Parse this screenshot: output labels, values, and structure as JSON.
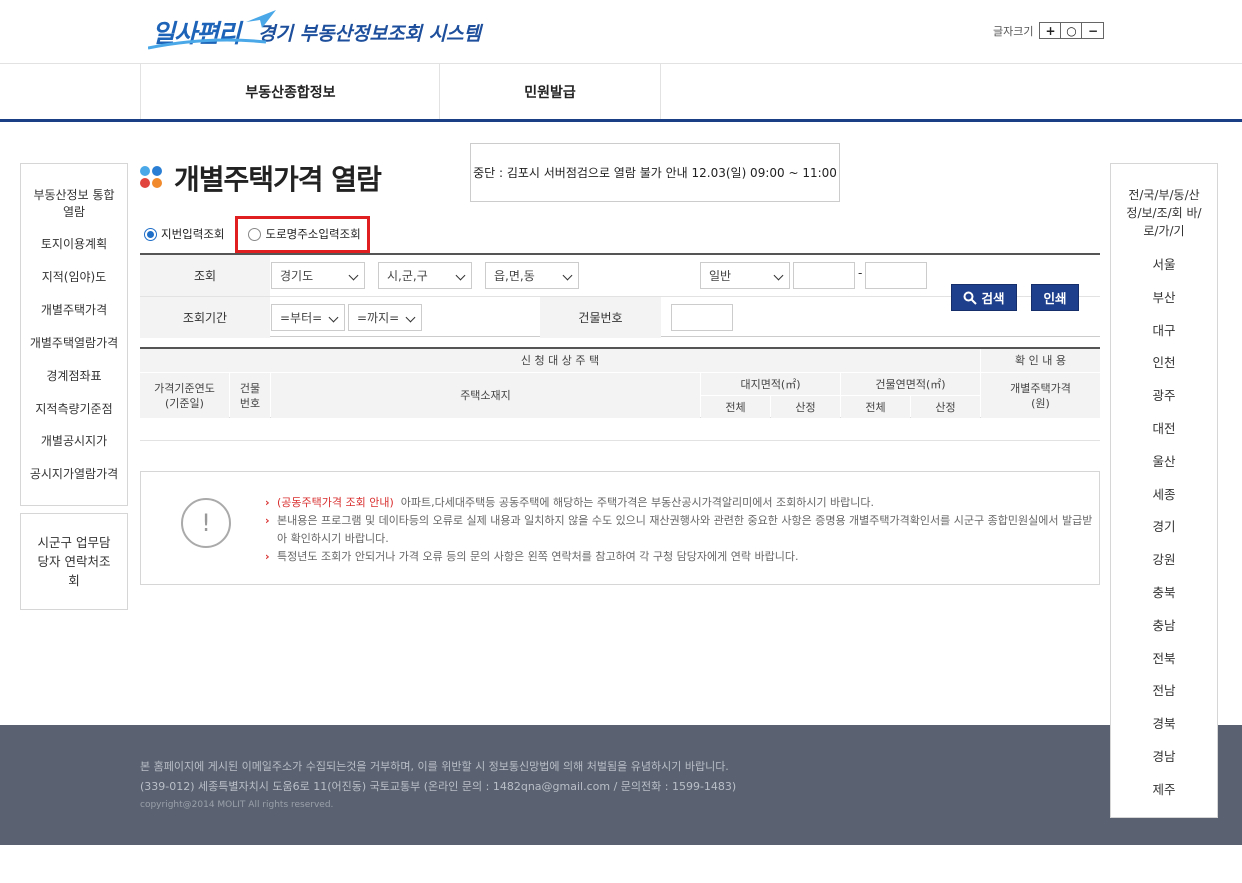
{
  "header": {
    "logo_mark": "일사편리",
    "title": "경기 부동산정보조회 시스템",
    "fontsize_label": "글자크기",
    "fontsize_buttons": [
      "+",
      "○",
      "−"
    ]
  },
  "nav": {
    "items": [
      "부동산종합정보",
      "민원발급"
    ]
  },
  "left_menu": {
    "items": [
      "부동산정보 통합 열람",
      "토지이용계획",
      "지적(임야)도",
      "개별주택가격",
      "개별주택열람가격",
      "경계점좌표",
      "지적측량기준점",
      "개별공시지가",
      "공시지가열람가격"
    ],
    "contact": "시군구 업무담당자 연락처조회"
  },
  "right_menu": {
    "heading": "전/국/부/동/산 정/보/조/회 바/로/가/기",
    "items": [
      "서울",
      "부산",
      "대구",
      "인천",
      "광주",
      "대전",
      "울산",
      "세종",
      "경기",
      "강원",
      "충북",
      "충남",
      "전북",
      "전남",
      "경북",
      "경남",
      "제주"
    ]
  },
  "page": {
    "title": "개별주택가격 열람",
    "notice": "중단 : 김포시 서버점검으로 열람 불가 안내 12.03(일) 09:00 ~ 11:00"
  },
  "radios": {
    "option1": "지번입력조회",
    "option2": "도로명주소입력조회",
    "selected": "option1"
  },
  "form": {
    "label_search": "조회",
    "label_period": "조회기간",
    "label_building": "건물번호",
    "sido": "경기도",
    "sigungu": "시,군,구",
    "eupmyeondong": "읍,면,동",
    "type": "일반",
    "dash": "-",
    "from": "=부터=",
    "to": "=까지=",
    "search_button": "검색",
    "print_button": "인쇄"
  },
  "table": {
    "group1": "신 청 대 상 주 택",
    "group2": "확 인 내 용",
    "col_year": "가격기준연도 (기준일)",
    "col_bldg": "건물 번호",
    "col_addr": "주택소재지",
    "col_land": "대지면적(㎡)",
    "col_floor": "건물연면적(㎡)",
    "col_total": "전체",
    "col_calc": "산정",
    "col_price": "개별주택가격 (원)"
  },
  "info": {
    "icon": "!",
    "line1_link": "(공동주택가격 조회 안내)",
    "line1_text": "아파트,다세대주택등 공동주택에 해당하는 주택가격은 부동산공시가격알리미에서 조회하시기 바랍니다.",
    "line2": "본내용은 프로그램 및 데이타등의 오류로 실제 내용과 일치하지 않을 수도 있으니 재산권행사와 관련한 중요한 사항은 증명용 개별주택가격확인서를 시군구 종합민원실에서 발급받아 확인하시기 바랍니다.",
    "line3": "특정년도 조회가 안되거나 가격 오류 등의 문의 사항은 왼쪽 연락처를 참고하여 각 구청 담당자에게 연락 바랍니다."
  },
  "footer": {
    "line1": "본 홈페이지에 게시된 이메일주소가 수집되는것을 거부하며, 이를 위반할 시 정보통신망법에 의해 처벌됨을 유념하시기 바랍니다.",
    "line2": "(339-012) 세종특별자치시 도움6로 11(어진동) 국토교통부 (온라인 문의 : 1482qna@gmail.com / 문의전화 : 1599-1483)",
    "copyright": "copyright@2014 MOLIT All rights reserved."
  },
  "colors": {
    "primary": "#1e3f8c",
    "dot_blue": "#2a7fd4",
    "dot_sky": "#4aa8e8",
    "dot_red": "#e0443c",
    "dot_orange": "#f08a2c",
    "highlight": "#e02020"
  }
}
